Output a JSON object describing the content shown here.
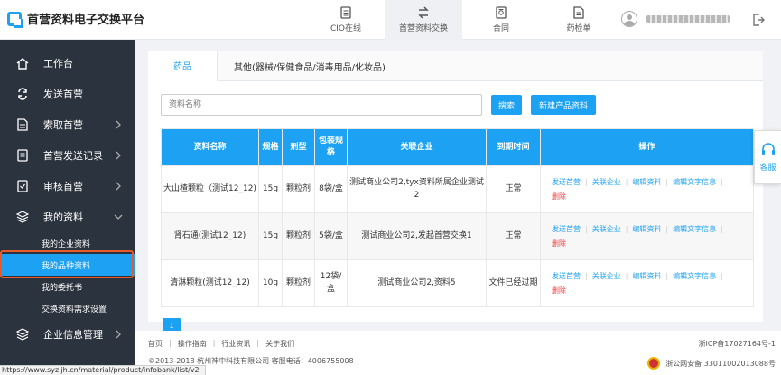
{
  "header": {
    "logo_text": "首营资料电子交换平台",
    "nav": [
      {
        "label": "CIO在线",
        "icon": "document-icon"
      },
      {
        "label": "首营资料交换",
        "icon": "swap-icon"
      },
      {
        "label": "合同",
        "icon": "contract-icon"
      },
      {
        "label": "药检单",
        "icon": "report-icon"
      }
    ]
  },
  "sidebar": {
    "items": [
      {
        "label": "工作台",
        "icon": "home-icon"
      },
      {
        "label": "发送首营",
        "icon": "send-icon"
      },
      {
        "label": "索取首营",
        "icon": "request-icon"
      },
      {
        "label": "首营发送记录",
        "icon": "record-icon"
      },
      {
        "label": "审核首营",
        "icon": "audit-icon"
      },
      {
        "label": "我的资料",
        "icon": "layers-icon"
      }
    ],
    "subitems": [
      "我的企业资料",
      "我的品种资料",
      "我的委托书",
      "交换资料需求设置"
    ],
    "bottom_item": {
      "label": "企业信息管理",
      "icon": "enterprise-icon"
    }
  },
  "tabs": [
    "药品",
    "其他(器械/保健食品/消毒用品/化妆品)"
  ],
  "search": {
    "placeholder": "资料名称",
    "search_label": "搜索",
    "new_label": "新建产品资料"
  },
  "table": {
    "headers": [
      "资料名称",
      "规格",
      "剂型",
      "包装规格",
      "关联企业",
      "到期时间",
      "操作"
    ],
    "rows": [
      {
        "name": "大山楂颗粒（测试12_12)",
        "spec": "15g",
        "form": "颗粒剂",
        "pack": "8袋/盒",
        "company": "测试商业公司2,tyx资料所属企业测试2",
        "expiry": "正常"
      },
      {
        "name": "肾石通(测试12_12)",
        "spec": "15g",
        "form": "颗粒剂",
        "pack": "5袋/盒",
        "company": "测试商业公司2,发起首营交换1",
        "expiry": "正常"
      },
      {
        "name": "清淋颗粒(测试12_12)",
        "spec": "10g",
        "form": "颗粒剂",
        "pack": "12袋/盒",
        "company": "测试商业公司2,资料5",
        "expiry": "文件已经过期"
      }
    ],
    "ops": {
      "send": "发送首营",
      "related": "关联企业",
      "edit": "编辑资料",
      "edit_text": "编辑文字信息",
      "delete": "删除"
    }
  },
  "pager": {
    "current": "1"
  },
  "footer": {
    "links": [
      "首页",
      "操作指南",
      "行业资讯",
      "关于我们"
    ],
    "copyright": "©2013-2018  杭州神中科技有限公司  客服电话：4006755008",
    "icp": "浙ICP备17027164号-1",
    "police": "浙公网安备 33011002013088号"
  },
  "service_label": "客服",
  "status_url": "https://www.syzljh.cn/material/product/infobank/list/v2",
  "colors": {
    "accent": "#1da1f2",
    "sidebar": "#2b333e",
    "highlight": "#e85a2a"
  }
}
